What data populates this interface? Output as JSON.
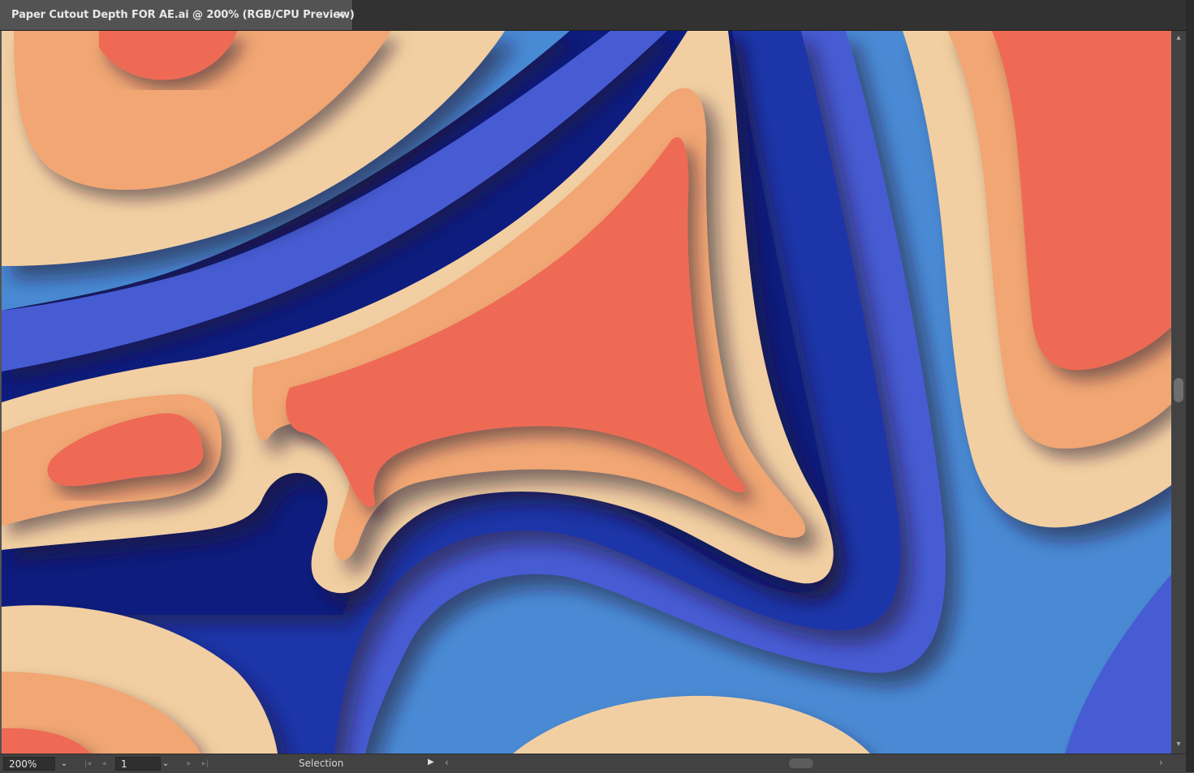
{
  "window": {
    "tab_title": "Paper Cutout Depth FOR AE.ai @ 200% (RGB/CPU Preview)",
    "close_glyph": "×"
  },
  "artwork": {
    "description_colors": {
      "coral": "#ee6a55",
      "light_orange": "#f1a673",
      "beige": "#f2cfa2",
      "sky_blue": "#4a8ad4",
      "royal_blue": "#465bd3",
      "deep_blue": "#1f35a8",
      "navy": "#0e1e7e"
    }
  },
  "statusbar": {
    "zoom": "200%",
    "page": "1",
    "tool": "Selection"
  },
  "icons": {
    "dropdown": "chevron-down-icon",
    "first_page": "first-page-icon",
    "prev_page": "prev-page-icon",
    "next_page": "next-page-icon",
    "last_page": "last-page-icon",
    "play": "play-icon",
    "scroll_up": "chevron-up-icon",
    "scroll_down": "chevron-down-icon",
    "scroll_left": "chevron-left-icon",
    "scroll_right": "chevron-right-icon"
  }
}
